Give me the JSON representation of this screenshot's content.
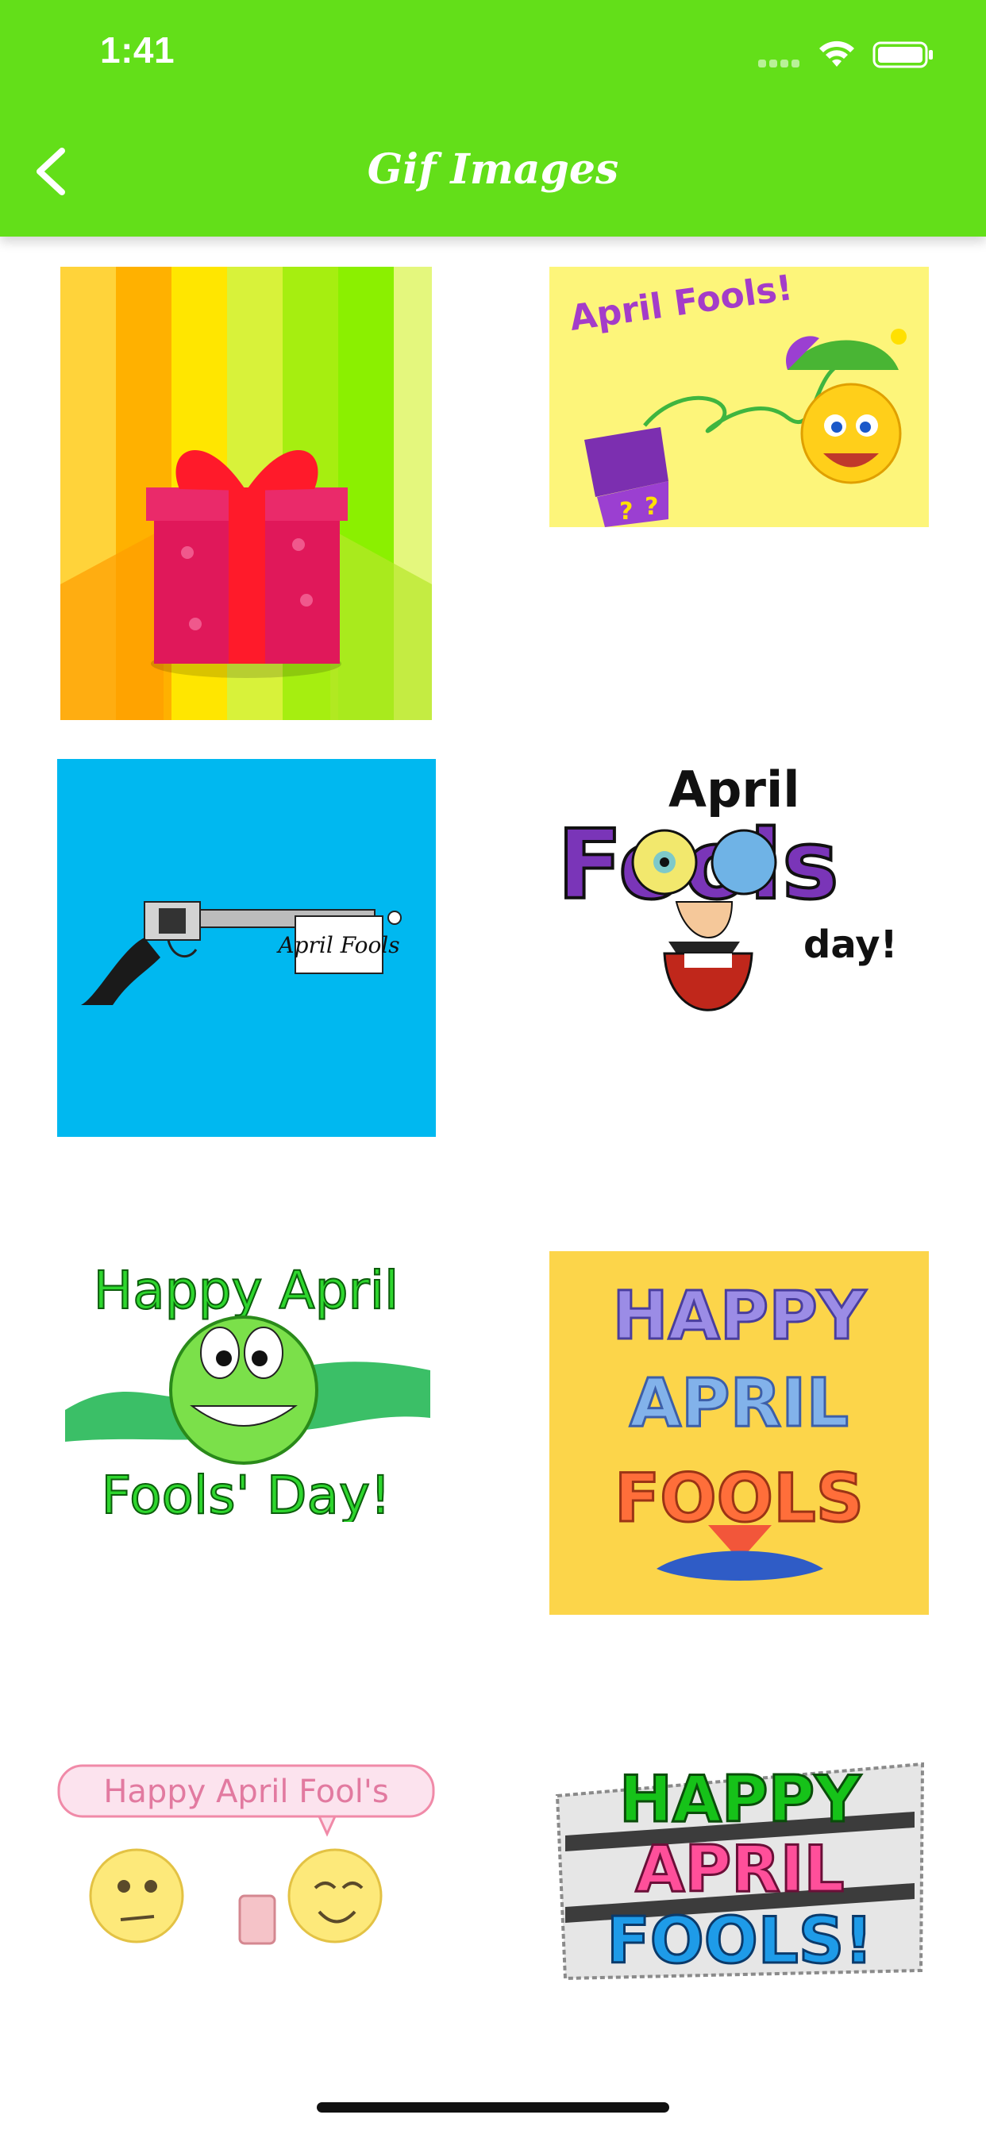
{
  "status_bar": {
    "time": "1:41"
  },
  "header": {
    "title": "Gif Images",
    "back_icon": "chevron-left-icon"
  },
  "gifs": [
    {
      "label": ""
    },
    {
      "label": "April Fools!"
    },
    {
      "label": "April Fools"
    },
    {
      "line1": "April",
      "line2": "Fools",
      "line3": "day!"
    },
    {
      "line1": "Happy April",
      "line2": "Fools' Day!"
    },
    {
      "line1": "HAPPY",
      "line2": "APRIL",
      "line3": "FOOLS"
    },
    {
      "label": "Happy April Fool's"
    },
    {
      "line1": "HAPPY",
      "line2": "APRIL",
      "line3": "FOOLS!"
    }
  ],
  "colors": {
    "header": "#63df19",
    "background": "#ffffff"
  }
}
